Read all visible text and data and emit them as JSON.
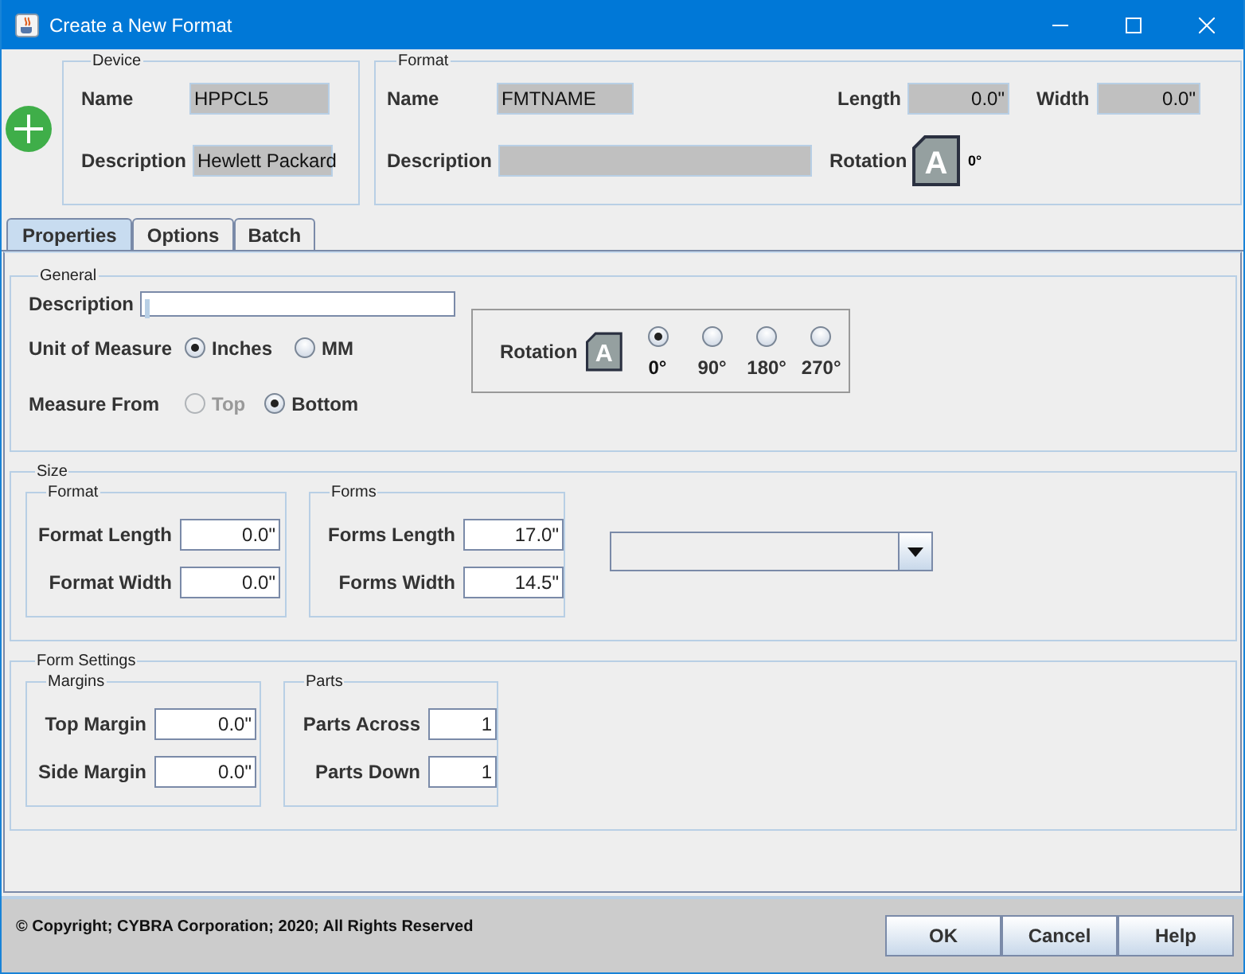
{
  "window": {
    "title": "Create a New Format"
  },
  "device": {
    "title": "Device",
    "name_label": "Name",
    "name": "HPPCL5",
    "description_label": "Description",
    "description": "Hewlett Packard"
  },
  "format": {
    "title": "Format",
    "name_label": "Name",
    "name": "FMTNAME",
    "length_label": "Length",
    "length": "0.0\"",
    "width_label": "Width",
    "width": "0.0\"",
    "description_label": "Description",
    "rotation_label": "Rotation",
    "rotation_glyph": "A",
    "rotation_value": "0°"
  },
  "tabs": [
    {
      "label": "Properties",
      "selected": true
    },
    {
      "label": "Options",
      "selected": false
    },
    {
      "label": "Batch",
      "selected": false
    }
  ],
  "general": {
    "title": "General",
    "description_label": "Description",
    "unit_label": "Unit of Measure",
    "units": [
      {
        "label": "Inches",
        "selected": true,
        "disabled": false
      },
      {
        "label": "MM",
        "selected": false,
        "disabled": false
      }
    ],
    "measure_from_label": "Measure From",
    "measure_from": [
      {
        "label": "Top",
        "selected": false,
        "disabled": true
      },
      {
        "label": "Bottom",
        "selected": true,
        "disabled": false
      }
    ],
    "rotation": {
      "label": "Rotation",
      "glyph": "A",
      "options": [
        {
          "label": "0°",
          "selected": true
        },
        {
          "label": "90°",
          "selected": false
        },
        {
          "label": "180°",
          "selected": false
        },
        {
          "label": "270°",
          "selected": false
        }
      ]
    }
  },
  "size": {
    "title": "Size",
    "groups": [
      {
        "title": "Format",
        "fields": [
          {
            "label": "Format Length",
            "value": "0.0\""
          },
          {
            "label": "Format Width",
            "value": "0.0\""
          }
        ]
      },
      {
        "title": "Forms",
        "fields": [
          {
            "label": "Forms Length",
            "value": "17.0\""
          },
          {
            "label": "Forms Width",
            "value": "14.5\""
          }
        ]
      }
    ]
  },
  "form_settings": {
    "title": "Form Settings",
    "groups": [
      {
        "title": "Margins",
        "fields": [
          {
            "label": "Top Margin",
            "value": "0.0\""
          },
          {
            "label": "Side Margin",
            "value": "0.0\""
          }
        ]
      },
      {
        "title": "Parts",
        "fields": [
          {
            "label": "Parts Across",
            "value": "1"
          },
          {
            "label": "Parts Down",
            "value": "1"
          }
        ]
      }
    ]
  },
  "footer": {
    "copyright": "© Copyright; CYBRA Corporation; 2020; All Rights Reserved",
    "buttons": [
      "OK",
      "Cancel",
      "Help"
    ]
  }
}
